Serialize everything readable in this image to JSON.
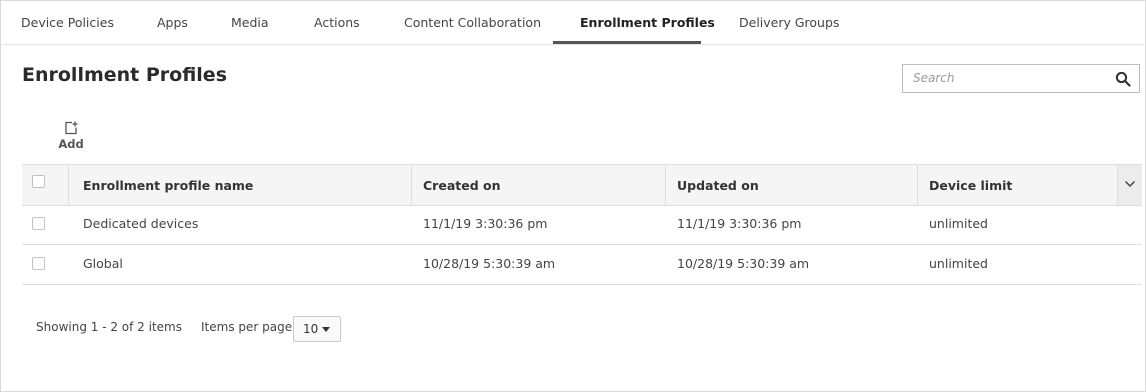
{
  "tabs": [
    {
      "label": "Device Policies"
    },
    {
      "label": "Apps"
    },
    {
      "label": "Media"
    },
    {
      "label": "Actions"
    },
    {
      "label": "Content Collaboration"
    },
    {
      "label": "Enrollment Profiles",
      "active": true
    },
    {
      "label": "Delivery Groups"
    }
  ],
  "page": {
    "title": "Enrollment Profiles"
  },
  "search": {
    "placeholder": "Search",
    "icon": "search-icon"
  },
  "toolbar": {
    "add_label": "Add",
    "add_icon": "add-icon"
  },
  "table": {
    "columns": [
      "Enrollment profile name",
      "Created on",
      "Updated on",
      "Device limit"
    ],
    "rows": [
      {
        "name": "Dedicated devices",
        "created": "11/1/19 3:30:36 pm",
        "updated": "11/1/19 3:30:36 pm",
        "limit": "unlimited"
      },
      {
        "name": "Global",
        "created": "10/28/19 5:30:39 am",
        "updated": "10/28/19 5:30:39 am",
        "limit": "unlimited"
      }
    ]
  },
  "pagination": {
    "showing": "Showing 1 - 2 of 2 items",
    "items_per_page_label": "Items per page:",
    "items_per_page_value": "10"
  },
  "colors": {
    "active_tab_underline": "#555555",
    "header_bg": "#f5f5f5",
    "border": "#dedede"
  }
}
